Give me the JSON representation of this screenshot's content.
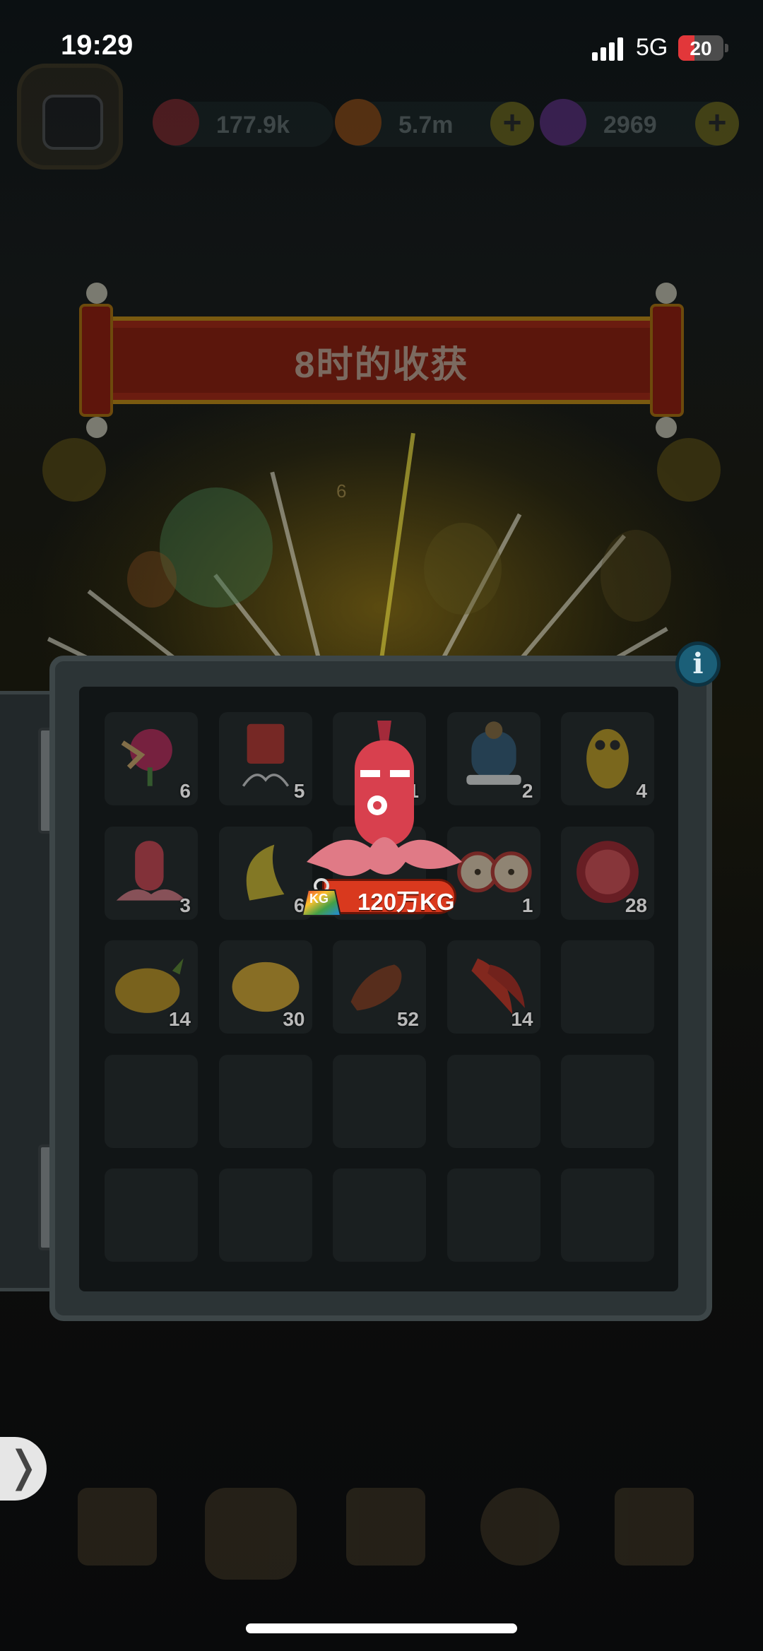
{
  "status_bar": {
    "time": "19:29",
    "network": "5G",
    "battery": "20",
    "battery_level": 0.2
  },
  "resources": [
    {
      "name": "orb",
      "value": "177.9k",
      "color": "#c0323a"
    },
    {
      "name": "coin",
      "value": "5.7m",
      "color": "#d96a12"
    },
    {
      "name": "potion",
      "value": "2969",
      "color": "#8a3cc0"
    }
  ],
  "banner": {
    "title": "8时的收获"
  },
  "background_badge": "6",
  "inventory": {
    "slots": [
      {
        "item": "dragon-flower-icon",
        "count": "6"
      },
      {
        "item": "red-jellyfish-icon",
        "count": "5"
      },
      {
        "item": "red-octopus-icon",
        "count": "1"
      },
      {
        "item": "armored-knight-icon",
        "count": "2"
      },
      {
        "item": "golden-owl-icon",
        "count": "4"
      },
      {
        "item": "small-red-octopus-icon",
        "count": "3"
      },
      {
        "item": "banana-creature-icon",
        "count": "6"
      },
      {
        "item": "hidden-item-icon",
        "count": ""
      },
      {
        "item": "apple-halves-icon",
        "count": "1"
      },
      {
        "item": "pomegranate-icon",
        "count": "28"
      },
      {
        "item": "pineapple-icon",
        "count": "14"
      },
      {
        "item": "potato-icon",
        "count": "30"
      },
      {
        "item": "scorpion-icon",
        "count": "52"
      },
      {
        "item": "chili-pepper-icon",
        "count": "14"
      },
      {
        "item": "",
        "count": ""
      },
      {
        "item": "",
        "count": ""
      },
      {
        "item": "",
        "count": ""
      },
      {
        "item": "",
        "count": ""
      },
      {
        "item": "",
        "count": ""
      },
      {
        "item": "",
        "count": ""
      },
      {
        "item": "",
        "count": ""
      },
      {
        "item": "",
        "count": ""
      },
      {
        "item": "",
        "count": ""
      },
      {
        "item": "",
        "count": ""
      },
      {
        "item": "",
        "count": ""
      }
    ]
  },
  "featured": {
    "item": "red-octopus-icon",
    "weight_label": "120万KG",
    "weight_icon_text": "KG"
  },
  "side_arrow": "❭"
}
